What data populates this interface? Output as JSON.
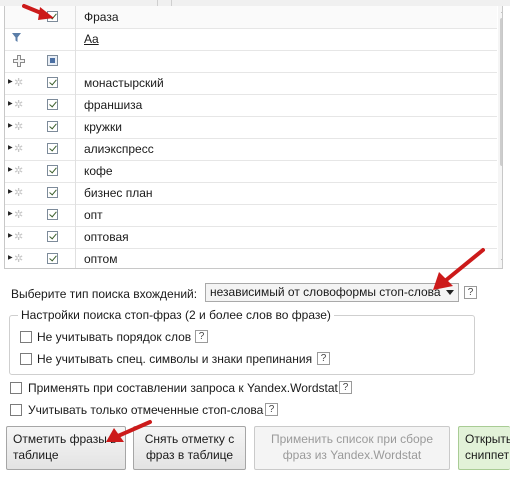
{
  "grid": {
    "header": {
      "col_title": "Фраза"
    },
    "filter_row": {
      "text_filter_label": "Aa"
    },
    "rows": [
      {
        "phrase": "монастырский",
        "checked": true
      },
      {
        "phrase": "франшиза",
        "checked": true
      },
      {
        "phrase": "кружки",
        "checked": true
      },
      {
        "phrase": "алиэкспресс",
        "checked": true
      },
      {
        "phrase": "кофе",
        "checked": true
      },
      {
        "phrase": "бизнес план",
        "checked": true
      },
      {
        "phrase": "опт",
        "checked": true
      },
      {
        "phrase": "оптовая",
        "checked": true
      },
      {
        "phrase": "оптом",
        "checked": true
      }
    ]
  },
  "search_type": {
    "label": "Выберите тип поиска вхождений:",
    "value": "независимый от словоформы стоп-слова",
    "help": "?"
  },
  "settings_group": {
    "title": "Настройки поиска стоп-фраз (2 и более слов во фразе)",
    "ignore_order": "Не учитывать порядок слов",
    "ignore_symbols": "Не учитывать спец. символы и знаки препинания"
  },
  "options": {
    "apply_wordstat": "Применять при составлении запроса к Yandex.Wordstat",
    "only_marked": "Учитывать только отмеченные стоп-слова"
  },
  "buttons": {
    "mark_line1": "Отметить фразы в",
    "mark_line2": "таблице",
    "unmark_line1": "Снять отметку с",
    "unmark_line2": "фраз в таблице",
    "apply_line1": "Применить список при сборе",
    "apply_line2": "фраз из Yandex.Wordstat",
    "open_line1": "Открыть",
    "open_line2": "сниппет"
  },
  "colors": {
    "annotation_arrow": "#cc1a1a",
    "green_button": "#e2f2d8"
  }
}
